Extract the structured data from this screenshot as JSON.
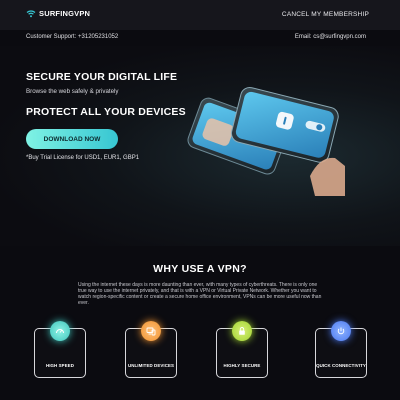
{
  "header": {
    "brand": "SURFINGVPN",
    "cancel_label": "CANCEL MY MEMBERSHIP"
  },
  "contact": {
    "support": "Customer Support: +31205231052",
    "email": "Email: cs@surfingvpn.com"
  },
  "hero": {
    "headline": "SECURE YOUR DIGITAL LIFE",
    "subheadline": "Browse the web safely & privately",
    "headline2": "PROTECT ALL YOUR DEVICES",
    "cta_label": "DOWNLOAD NOW",
    "note": "*Buy Trial License for USD1, EUR1, GBP1"
  },
  "why": {
    "title": "WHY USE A VPN?",
    "paragraph": "Using the internet these days is more daunting than ever, with many types of cyberthreats. There is only one true way to use the internet privately, and that is with a VPN or Virtual Private Network. Whether you want to watch region-specific content or create a secure home office environment, VPNs can be more useful now than ever."
  },
  "features": [
    {
      "label": "HIGH SPEED",
      "icon": "speedometer-icon",
      "color": "#3ec4bb"
    },
    {
      "label": "UNLIMITED DEVICES",
      "icon": "devices-icon",
      "color": "#f0922e"
    },
    {
      "label": "HIGHLY SECURE",
      "icon": "lock-icon",
      "color": "#9fd22e"
    },
    {
      "label": "QUICK CONNECTIVITY",
      "icon": "connect-icon",
      "color": "#4a78f0"
    }
  ],
  "colors": {
    "accent": "#37c6d2",
    "background": "#0b0b10"
  }
}
